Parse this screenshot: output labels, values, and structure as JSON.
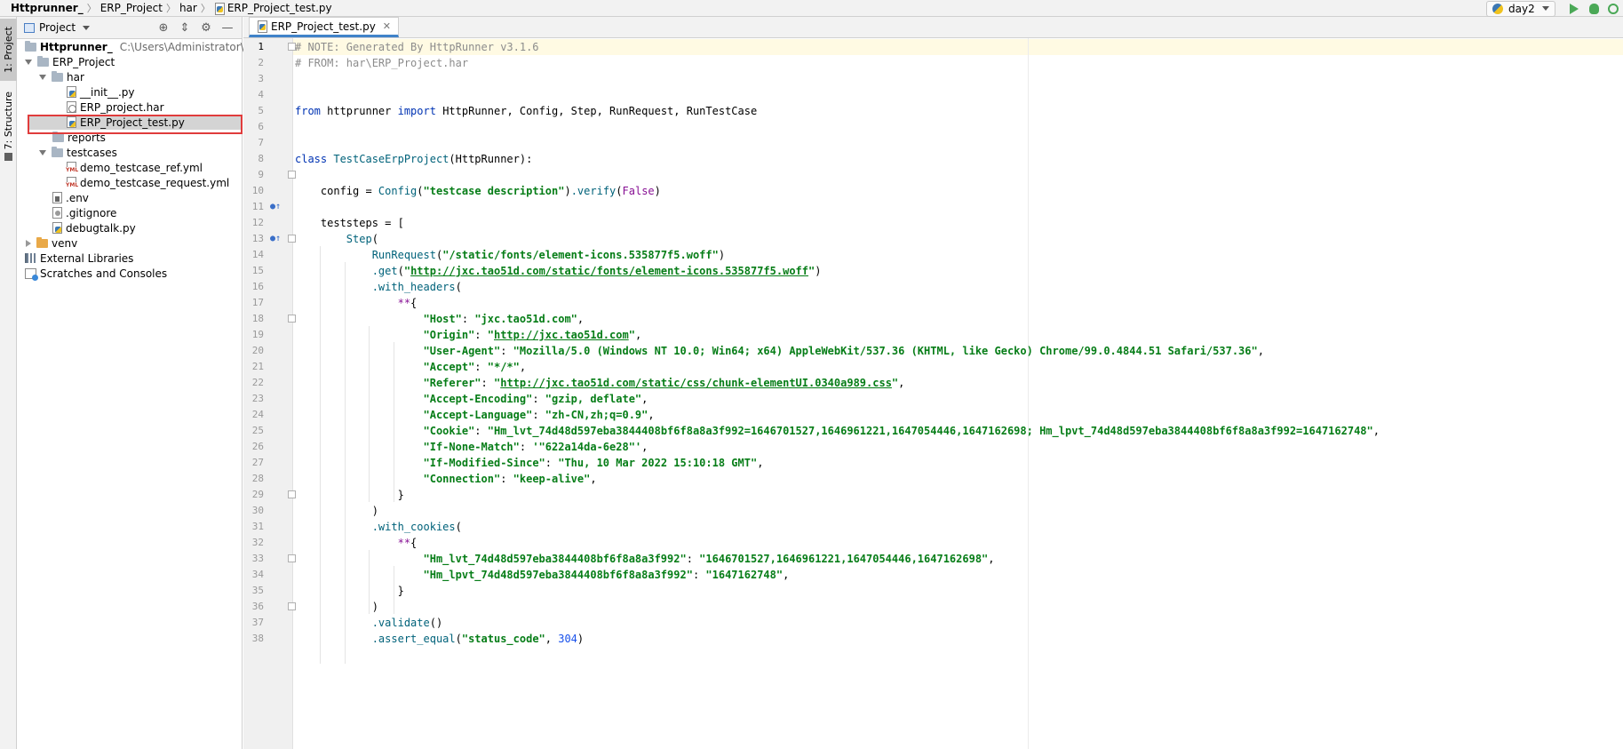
{
  "breadcrumb": [
    "Httprunner_",
    "ERP_Project",
    "har",
    "ERP_Project_test.py"
  ],
  "toolbar": {
    "run_config": "day2"
  },
  "tool_strip": {
    "project_tab": "1: Project",
    "structure_tab": "7: Structure"
  },
  "project_panel": {
    "title": "Project",
    "root": {
      "name": "Httprunner_",
      "path": "C:\\Users\\Administrator\\Pycharm"
    },
    "items": [
      {
        "label": "ERP_Project"
      },
      {
        "label": "har"
      },
      {
        "label": "__init__.py"
      },
      {
        "label": "ERP_project.har"
      },
      {
        "label": "ERP_Project_test.py"
      },
      {
        "label": "reports"
      },
      {
        "label": "testcases"
      },
      {
        "label": "demo_testcase_ref.yml"
      },
      {
        "label": "demo_testcase_request.yml"
      },
      {
        "label": ".env"
      },
      {
        "label": ".gitignore"
      },
      {
        "label": "debugtalk.py"
      },
      {
        "label": "venv"
      },
      {
        "label": "External Libraries"
      },
      {
        "label": "Scratches and Consoles"
      }
    ]
  },
  "editor": {
    "tab_label": "ERP_Project_test.py",
    "lines": [
      "# NOTE: Generated By HttpRunner v3.1.6",
      "# FROM: har\\ERP_Project.har",
      "",
      "",
      "from httprunner import HttpRunner, Config, Step, RunRequest, RunTestCase",
      "",
      "",
      "class TestCaseErpProject(HttpRunner):",
      "",
      "    config = Config(\"testcase description\").verify(False)",
      "",
      "    teststeps = [",
      "        Step(",
      "            RunRequest(\"/static/fonts/element-icons.535877f5.woff\")",
      "            .get(\"http://jxc.tao51d.com/static/fonts/element-icons.535877f5.woff\")",
      "            .with_headers(",
      "                **{",
      "                    \"Host\": \"jxc.tao51d.com\",",
      "                    \"Origin\": \"http://jxc.tao51d.com\",",
      "                    \"User-Agent\": \"Mozilla/5.0 (Windows NT 10.0; Win64; x64) AppleWebKit/537.36 (KHTML, like Gecko) Chrome/99.0.4844.51 Safari/537.36\",",
      "                    \"Accept\": \"*/*\",",
      "                    \"Referer\": \"http://jxc.tao51d.com/static/css/chunk-elementUI.0340a989.css\",",
      "                    \"Accept-Encoding\": \"gzip, deflate\",",
      "                    \"Accept-Language\": \"zh-CN,zh;q=0.9\",",
      "                    \"Cookie\": \"Hm_lvt_74d48d597eba3844408bf6f8a8a3f992=1646701527,1646961221,1647054446,1647162698; Hm_lpvt_74d48d597eba3844408bf6f8a8a3f992=1647162748\",",
      "                    \"If-None-Match\": '\"622a14da-6e28\"',",
      "                    \"If-Modified-Since\": \"Thu, 10 Mar 2022 15:10:18 GMT\",",
      "                    \"Connection\": \"keep-alive\",",
      "                }",
      "            )",
      "            .with_cookies(",
      "                **{",
      "                    \"Hm_lvt_74d48d597eba3844408bf6f8a8a3f992\": \"1646701527,1646961221,1647054446,1647162698\",",
      "                    \"Hm_lpvt_74d48d597eba3844408bf6f8a8a3f992\": \"1647162748\",",
      "                }",
      "            )",
      "            .validate()",
      "            .assert_equal(\"status_code\", 304)"
    ]
  },
  "colors": {
    "selection_outline": "#e03c3c",
    "tab_underline": "#4083c9",
    "run_green": "#4aa856"
  }
}
